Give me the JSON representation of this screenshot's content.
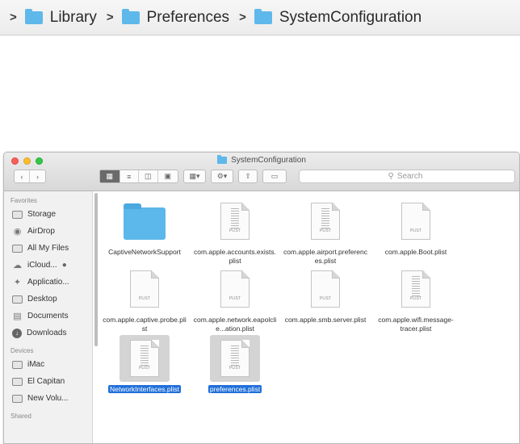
{
  "pathbar": {
    "crumbs": [
      {
        "label": "Library"
      },
      {
        "label": "Preferences"
      },
      {
        "label": "SystemConfiguration"
      }
    ]
  },
  "window": {
    "title": "SystemConfiguration",
    "search_placeholder": "Search"
  },
  "sidebar": {
    "favorites_heading": "Favorites",
    "favorites": [
      {
        "label": "Storage",
        "icon": "storage-icon"
      },
      {
        "label": "AirDrop",
        "icon": "airdrop-icon"
      },
      {
        "label": "All My Files",
        "icon": "all-my-files-icon"
      },
      {
        "label": "iCloud...",
        "icon": "icloud-icon"
      },
      {
        "label": "Applicatio...",
        "icon": "applications-icon"
      },
      {
        "label": "Desktop",
        "icon": "desktop-icon"
      },
      {
        "label": "Documents",
        "icon": "documents-icon"
      },
      {
        "label": "Downloads",
        "icon": "downloads-icon"
      }
    ],
    "devices_heading": "Devices",
    "devices": [
      {
        "label": "iMac",
        "icon": "imac-icon"
      },
      {
        "label": "El Capitan",
        "icon": "disk-icon"
      },
      {
        "label": "New Volu...",
        "icon": "disk-icon"
      }
    ],
    "shared_heading": "Shared"
  },
  "files": [
    {
      "name": "CaptiveNetworkSupport",
      "kind": "folder",
      "selected": false
    },
    {
      "name": "com.apple.accounts.exists.plist",
      "kind": "plist",
      "selected": false
    },
    {
      "name": "com.apple.airport.preferences.plist",
      "kind": "plist",
      "selected": false
    },
    {
      "name": "com.apple.Boot.plist",
      "kind": "plist",
      "selected": false
    },
    {
      "name": "com.apple.captive.probe.plist",
      "kind": "plist",
      "selected": false
    },
    {
      "name": "com.apple.network.eapolclie...ation.plist",
      "kind": "plist",
      "selected": false
    },
    {
      "name": "com.apple.smb.server.plist",
      "kind": "plist",
      "selected": false
    },
    {
      "name": "com.apple.wifi.message-tracer.plist",
      "kind": "plist",
      "selected": false
    },
    {
      "name": "NetworkInterfaces.plist",
      "kind": "plist",
      "selected": true
    },
    {
      "name": "preferences.plist",
      "kind": "plist",
      "selected": true
    }
  ],
  "plist_badge": "PLIST"
}
